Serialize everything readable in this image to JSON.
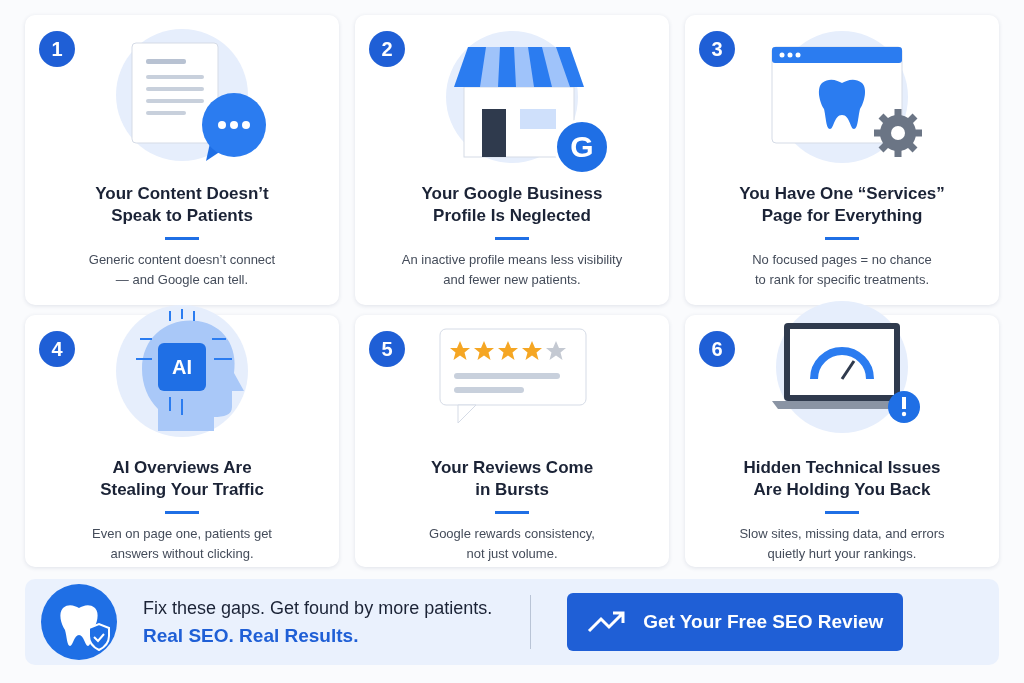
{
  "cards": [
    {
      "number": "1",
      "kind": "document-chat",
      "title": "Your Content Doesn’t\nSpeak to Patients",
      "text": "Generic content doesn’t connect\n— and Google can tell."
    },
    {
      "number": "2",
      "kind": "storefront",
      "logo_letter": "G",
      "title": "Your Google Business\nProfile Is Neglected",
      "text": "An inactive profile means less visibility\nand fewer new patients."
    },
    {
      "number": "3",
      "kind": "browser-tooth",
      "title": "You Have One “Services”\nPage for Everything",
      "text": "No focused pages = no chance\nto rank for specific treatments."
    },
    {
      "number": "4",
      "kind": "ai-head",
      "chip_label": "AI",
      "title": "AI Overviews Are\nStealing Your Traffic",
      "text": "Even on page one, patients get\nanswers without clicking."
    },
    {
      "number": "5",
      "kind": "review",
      "stars": 4,
      "title": "Your Reviews Come\nin Bursts",
      "text": "Google rewards consistency,\nnot just volume."
    },
    {
      "number": "6",
      "kind": "laptop-gauge",
      "title": "Hidden Technical Issues\nAre Holding You Back",
      "text": "Slow sites, missing data, and errors\nquietly hurt your rankings."
    }
  ],
  "banner": {
    "line": "Fix these gaps. Get found by more patients.",
    "tagline": "Real SEO. Real Results.",
    "button": "Get Your Free SEO Review"
  }
}
